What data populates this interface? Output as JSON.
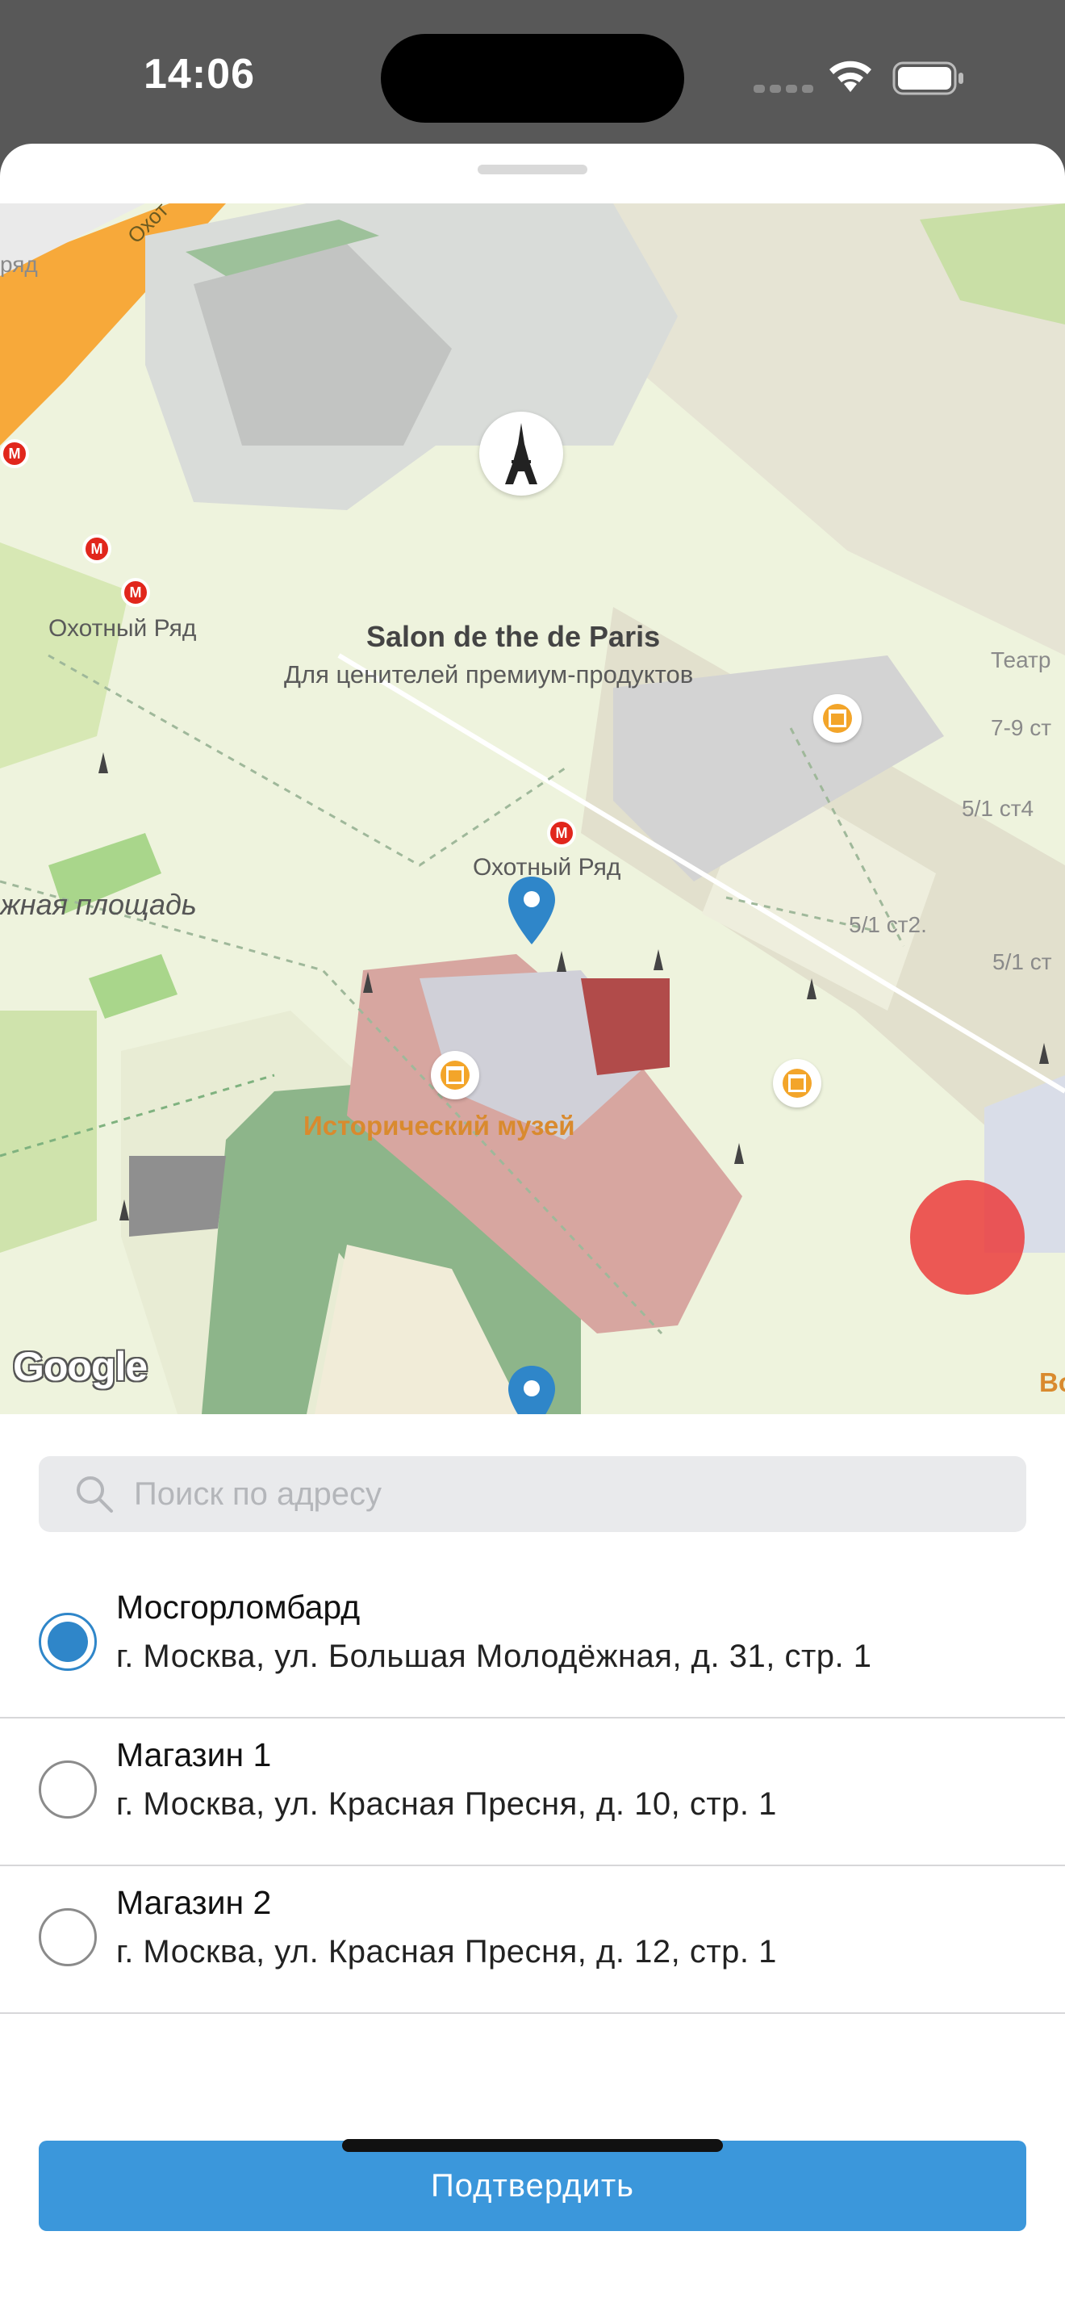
{
  "status_bar": {
    "time": "14:06"
  },
  "map": {
    "labels": {
      "okhotny_ryad_1": "Охотный Ряд",
      "okhotny_ryad_2": "Охотный Ряд",
      "salon_title": "Salon de the de Paris",
      "salon_subtitle": "Для ценителей премиум-продуктов",
      "square": "жная площадь",
      "museum": "Исторический музей",
      "ryad_top": "ряд",
      "okhot_road": "Охот",
      "teatr": "Театр",
      "bld_1": "7-9 ст",
      "bld_2": "5/1 ст4",
      "bld_3": "5/1 ст2.",
      "bld_4": "5/1 ст",
      "vo": "Во"
    },
    "attribution": "Google",
    "metro_glyph": "М",
    "colors": {
      "pin": "#2f86c9",
      "selected_marker": "#eb3c3c",
      "metro": "#e1261c",
      "museum_accent": "#f3a52a"
    }
  },
  "search": {
    "placeholder": "Поиск по адресу",
    "value": ""
  },
  "stores": [
    {
      "name": "Мосгорломбард",
      "address": "г. Москва, ул. Большая Молодёжная, д. 31, стр. 1",
      "selected": true
    },
    {
      "name": "Магазин 1",
      "address": "г. Москва, ул. Красная Пресня, д. 10, стр. 1",
      "selected": false
    },
    {
      "name": "Магазин 2",
      "address": "г. Москва, ул. Красная Пресня, д. 12, стр. 1",
      "selected": false
    }
  ],
  "confirm_label": "Подтвердить",
  "colors": {
    "accent": "#3b97db",
    "radio_selected": "#2f86c9"
  }
}
